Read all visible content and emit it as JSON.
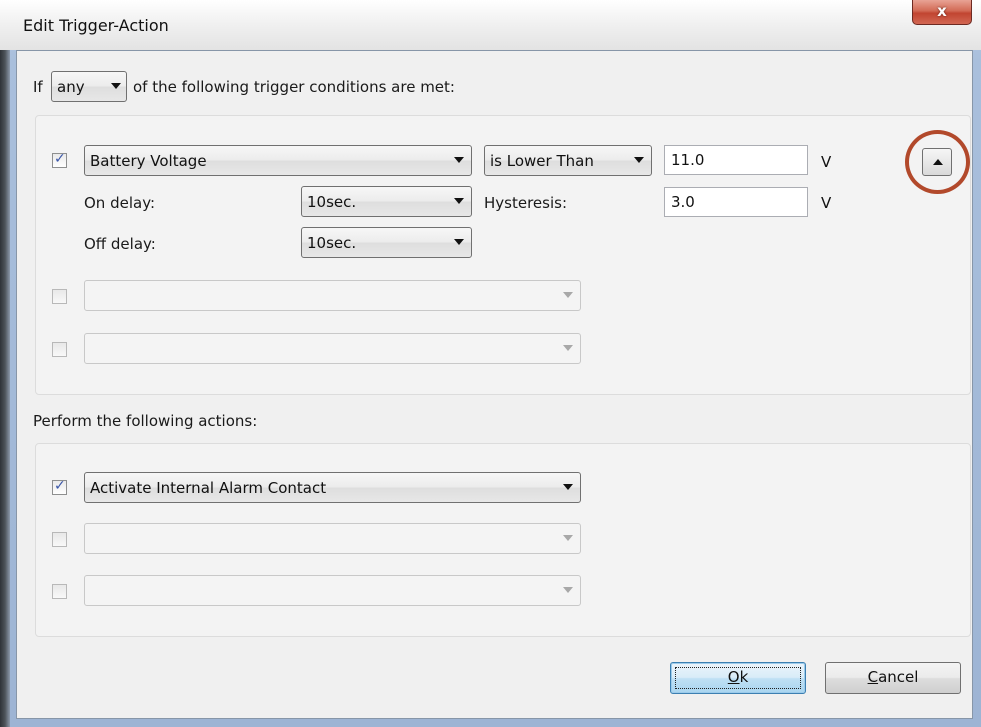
{
  "window": {
    "title": "Edit Trigger-Action",
    "close_label": "x"
  },
  "trigger_header": {
    "prefix": "If",
    "match_mode": "any",
    "suffix": "of the following trigger conditions are met:"
  },
  "conditions": [
    {
      "checked": true,
      "source": "Battery Voltage",
      "comparator": "is Lower Than",
      "threshold": "11.0",
      "threshold_unit": "V",
      "on_delay_label": "On delay:",
      "on_delay": "10sec.",
      "hysteresis_label": "Hysteresis:",
      "hysteresis": "3.0",
      "hysteresis_unit": "V",
      "off_delay_label": "Off delay:",
      "off_delay": "10sec."
    },
    {
      "checked": false,
      "source": ""
    },
    {
      "checked": false,
      "source": ""
    }
  ],
  "actions_header": "Perform the following actions:",
  "actions": [
    {
      "checked": true,
      "action": "Activate Internal Alarm Contact"
    },
    {
      "checked": false,
      "action": ""
    },
    {
      "checked": false,
      "action": ""
    }
  ],
  "checkmark_glyph": "✓",
  "icons": {
    "move_up": "triangle-up-icon",
    "dropdown": "chevron-down-icon"
  },
  "buttons": {
    "ok_prefix": "",
    "ok_access_key": "O",
    "ok_rest": "k",
    "cancel_access_key": "C",
    "cancel_rest": "ancel"
  },
  "colors": {
    "highlight_ring": "#b2492b",
    "check_mark": "#3b57a8",
    "default_button_border": "#3c7fb1"
  }
}
